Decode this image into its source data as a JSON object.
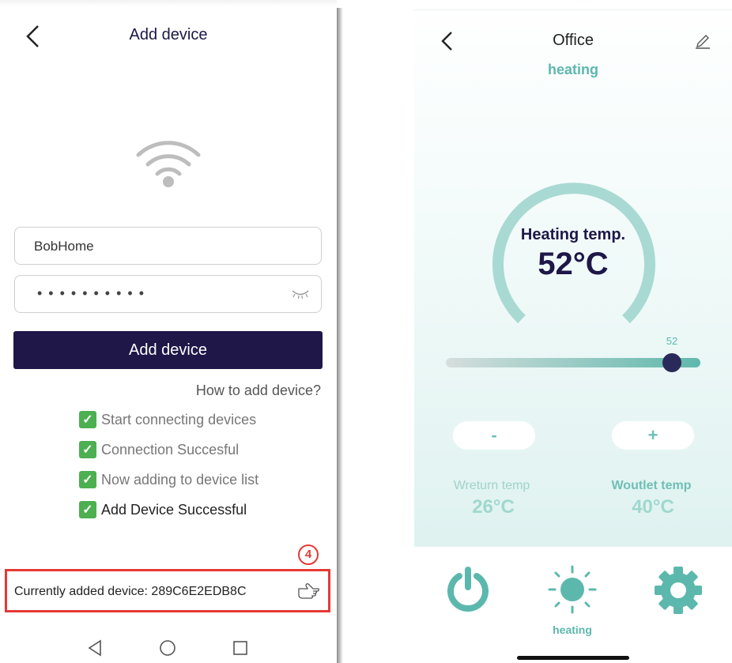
{
  "left": {
    "title": "Add device",
    "ssid_value": "BobHome",
    "password_mask": "••••••••••",
    "add_button_label": "Add device",
    "how_to_link": "How to add device?",
    "steps": [
      {
        "label": "Start connecting devices",
        "done": true
      },
      {
        "label": "Connection Succesful",
        "done": true
      },
      {
        "label": "Now adding to device list",
        "done": true
      },
      {
        "label": "Add Device Successful",
        "done": true
      }
    ],
    "step_number": "4",
    "current_device_text": "Currently added device: 289C6E2EDB8C"
  },
  "right": {
    "title": "Office",
    "mode": "heating",
    "gauge_label": "Heating temp.",
    "gauge_value": "52°C",
    "slider": {
      "value": 52,
      "min": 0,
      "max": 55
    },
    "minus_label": "-",
    "plus_label": "+",
    "return_label": "Wreturn temp",
    "return_value": "26°C",
    "outlet_label": "Woutlet temp",
    "outlet_value": "40°C",
    "mode_tab_label": "heating"
  },
  "colors": {
    "brand_dark": "#1e1748",
    "teal": "#5cb8ad",
    "highlight_red": "#e53935",
    "check_green": "#4caf50"
  }
}
